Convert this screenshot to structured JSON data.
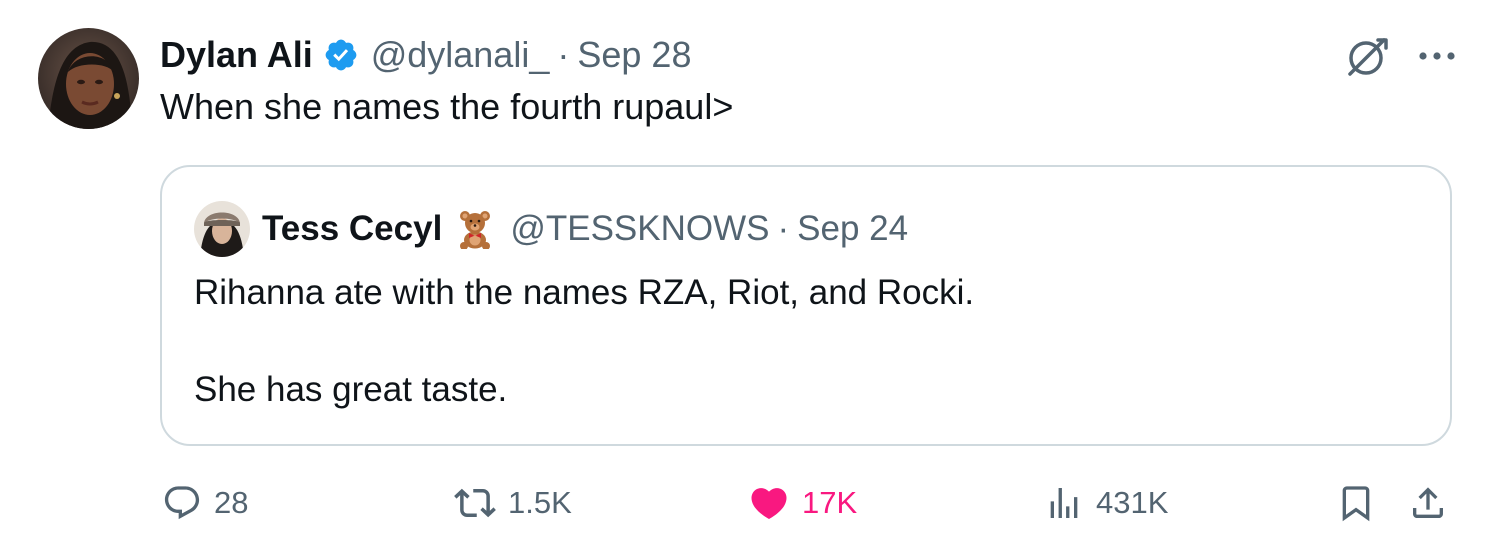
{
  "tweet": {
    "author": {
      "name": "Dylan Ali",
      "handle": "@dylanali_",
      "verified": true,
      "separator": "·",
      "time": "Sep 28"
    },
    "text": "When she names the fourth rupaul>",
    "quoted": {
      "author": {
        "name": "Tess Cecyl",
        "emoji_icon": "teddy-bear-icon",
        "handle": "@TESSKNOWS",
        "separator": "·",
        "time": "Sep 24"
      },
      "lines": [
        "Rihanna ate with the names RZA, Riot, and Rocki.",
        "",
        "She has great taste."
      ]
    },
    "stats": {
      "replies": "28",
      "reposts": "1.5K",
      "likes": "17K",
      "views": "431K"
    },
    "liked": true
  },
  "colors": {
    "text": "#0f1419",
    "secondary": "#536471",
    "verified": "#1d9bf0",
    "like": "#f91880",
    "border": "#cfd9de"
  }
}
